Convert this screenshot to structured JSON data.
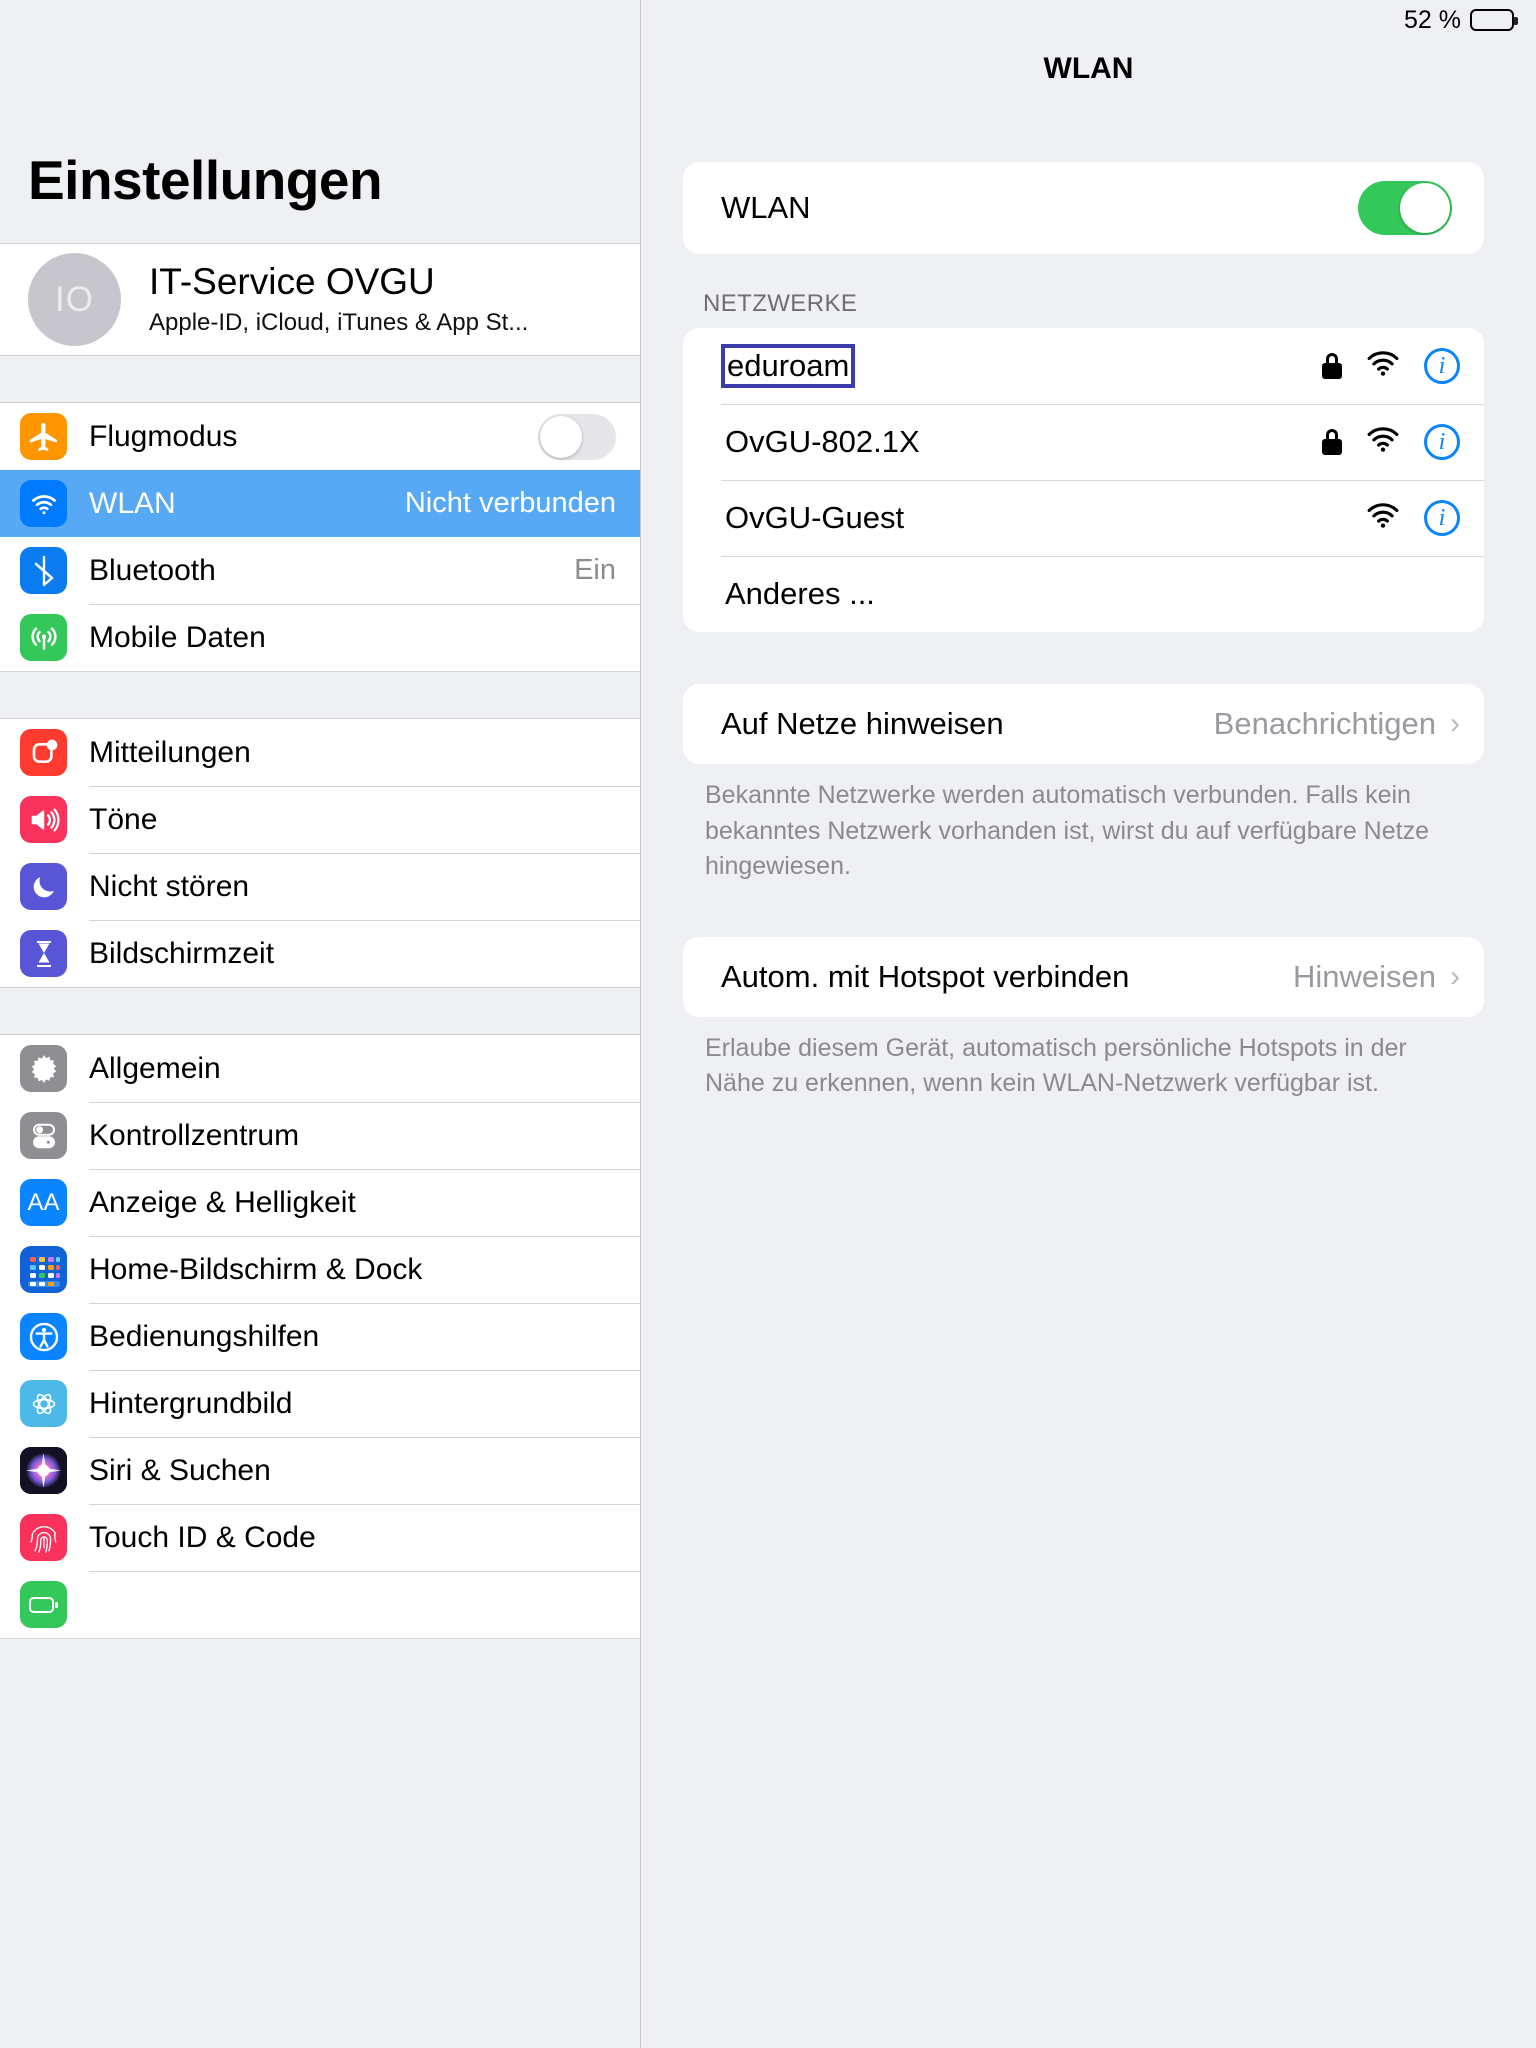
{
  "statusbar": {
    "battery_percent": "52 %",
    "battery_level": 52
  },
  "sidebar": {
    "title": "Einstellungen",
    "account": {
      "initials": "IO",
      "name": "IT-Service OVGU",
      "subtitle": "Apple-ID, iCloud, iTunes & App St..."
    },
    "group1": [
      {
        "label": "Flugmodus",
        "icon": "airplane-icon",
        "control": "toggle",
        "toggle_on": false
      },
      {
        "label": "WLAN",
        "icon": "wifi-icon",
        "value": "Nicht verbunden",
        "selected": true
      },
      {
        "label": "Bluetooth",
        "icon": "bluetooth-icon",
        "value": "Ein"
      },
      {
        "label": "Mobile Daten",
        "icon": "cellular-icon"
      }
    ],
    "group2": [
      {
        "label": "Mitteilungen",
        "icon": "notifications-icon"
      },
      {
        "label": "Töne",
        "icon": "sounds-icon"
      },
      {
        "label": "Nicht stören",
        "icon": "moon-icon"
      },
      {
        "label": "Bildschirmzeit",
        "icon": "hourglass-icon"
      }
    ],
    "group3": [
      {
        "label": "Allgemein",
        "icon": "gear-icon"
      },
      {
        "label": "Kontrollzentrum",
        "icon": "control-center-icon"
      },
      {
        "label": "Anzeige & Helligkeit",
        "icon": "display-brightness-icon"
      },
      {
        "label": "Home-Bildschirm & Dock",
        "icon": "home-screen-dock-icon"
      },
      {
        "label": "Bedienungshilfen",
        "icon": "accessibility-icon"
      },
      {
        "label": "Hintergrundbild",
        "icon": "wallpaper-icon"
      },
      {
        "label": "Siri & Suchen",
        "icon": "siri-icon"
      },
      {
        "label": "Touch ID & Code",
        "icon": "touch-id-icon"
      },
      {
        "label": "",
        "icon": "battery-green-icon"
      }
    ]
  },
  "pane": {
    "title": "WLAN",
    "wlan_toggle": {
      "label": "WLAN",
      "on": true
    },
    "networks_header": "NETZWERKE",
    "networks": [
      {
        "name": "eduroam",
        "secured": true,
        "wifi": true,
        "info": true,
        "focused": true
      },
      {
        "name": "OvGU-802.1X",
        "secured": true,
        "wifi": true,
        "info": true,
        "focused": false
      },
      {
        "name": "OvGU-Guest",
        "secured": false,
        "wifi": true,
        "info": true,
        "focused": false
      },
      {
        "name": "Anderes ...",
        "secured": false,
        "wifi": false,
        "info": false,
        "focused": false
      }
    ],
    "ask_networks": {
      "label": "Auf Netze hinweisen",
      "value": "Benachrichtigen",
      "chevron": "›",
      "footnote": "Bekannte Netzwerke werden automatisch verbunden. Falls kein bekanntes Netzwerk vorhanden ist, wirst du auf verfügbare Netze hingewiesen."
    },
    "hotspot": {
      "label": "Autom. mit Hotspot verbinden",
      "value": "Hinweisen",
      "chevron": "›",
      "footnote": "Erlaube diesem Gerät, automatisch persönliche Hotspots in der Nähe zu erkennen, wenn kein WLAN-Netzwerk verfügbar ist."
    }
  },
  "colors": {
    "selection_blue": "#57a8f5",
    "toggle_green": "#34c759",
    "info_blue": "#0a84ff",
    "focus_outline": "#3b3bac"
  }
}
